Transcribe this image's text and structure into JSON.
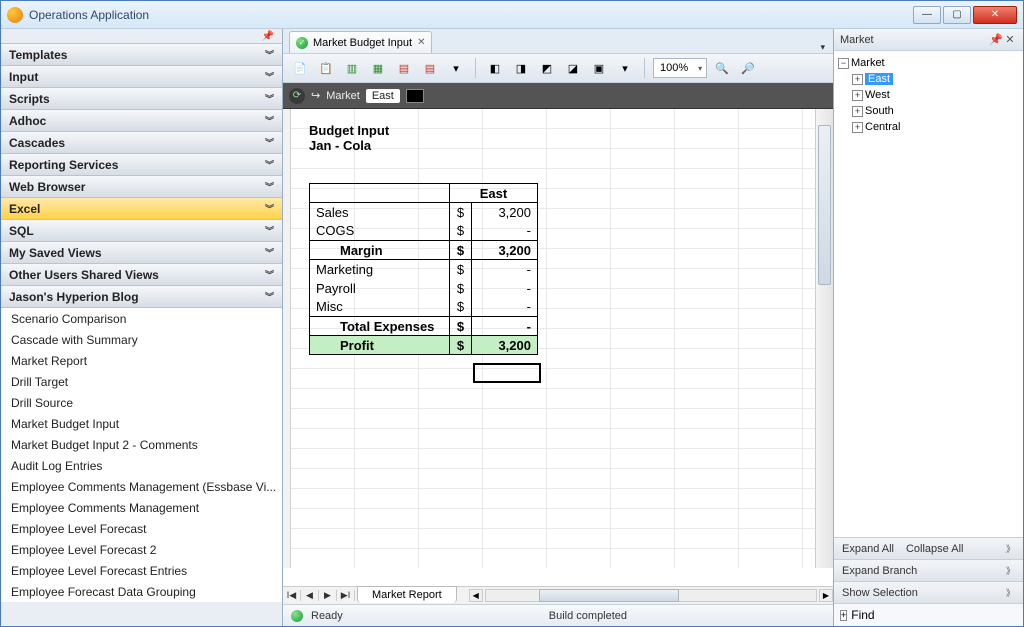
{
  "window": {
    "title": "Operations Application"
  },
  "win_controls": {
    "min": "—",
    "max": "▢",
    "close": "✕"
  },
  "faded_menu": "…",
  "left_panel": {
    "sections": [
      {
        "label": "Templates"
      },
      {
        "label": "Input"
      },
      {
        "label": "Scripts"
      },
      {
        "label": "Adhoc"
      },
      {
        "label": "Cascades"
      },
      {
        "label": "Reporting Services"
      },
      {
        "label": "Web Browser"
      },
      {
        "label": "Excel",
        "active": true
      },
      {
        "label": "SQL"
      },
      {
        "label": "My Saved Views"
      },
      {
        "label": "Other Users Shared Views"
      },
      {
        "label": "Jason's Hyperion Blog",
        "expanded": true
      }
    ],
    "blog_items": [
      "Scenario Comparison",
      "Cascade with Summary",
      "Market Report",
      "Drill Target",
      "Drill Source",
      "Market Budget Input",
      "Market Budget Input 2 - Comments",
      "Audit Log Entries",
      "Employee Comments Management (Essbase Vi...",
      "Employee Comments Management",
      "Employee Level Forecast",
      "Employee Level Forecast 2",
      "Employee Level Forecast Entries",
      "Employee Forecast Data Grouping"
    ]
  },
  "tab": {
    "label": "Market Budget Input",
    "close": "✕"
  },
  "toolbar": {
    "zoom": "100%"
  },
  "pov": {
    "dim": "Market",
    "member": "East"
  },
  "budget": {
    "title1": "Budget Input",
    "title2": "Jan - Cola",
    "col_header": "East",
    "currency": "$",
    "rows": [
      {
        "label": "Sales",
        "value": "3,200"
      },
      {
        "label": "COGS",
        "value": "-"
      },
      {
        "label": "Margin",
        "value": "3,200",
        "bold": true,
        "indent": true,
        "sec": "both"
      },
      {
        "label": "Marketing",
        "value": "-"
      },
      {
        "label": "Payroll",
        "value": "-"
      },
      {
        "label": "Misc",
        "value": "-"
      },
      {
        "label": "Total Expenses",
        "value": "-",
        "bold": true,
        "indent": true,
        "sec": "top"
      },
      {
        "label": "Profit",
        "value": "3,200",
        "bold": true,
        "indent": true,
        "profit": true,
        "sec": "both"
      }
    ]
  },
  "sheet_tab": "Market Report",
  "status": {
    "ready": "Ready",
    "build": "Build completed"
  },
  "right_panel": {
    "title": "Market",
    "root": "Market",
    "children": [
      "East",
      "West",
      "South",
      "Central"
    ],
    "selected": "East",
    "actions": {
      "expand_all": "Expand All",
      "collapse_all": "Collapse All",
      "expand_branch": "Expand Branch",
      "show_selection": "Show Selection",
      "find": "Find"
    }
  }
}
